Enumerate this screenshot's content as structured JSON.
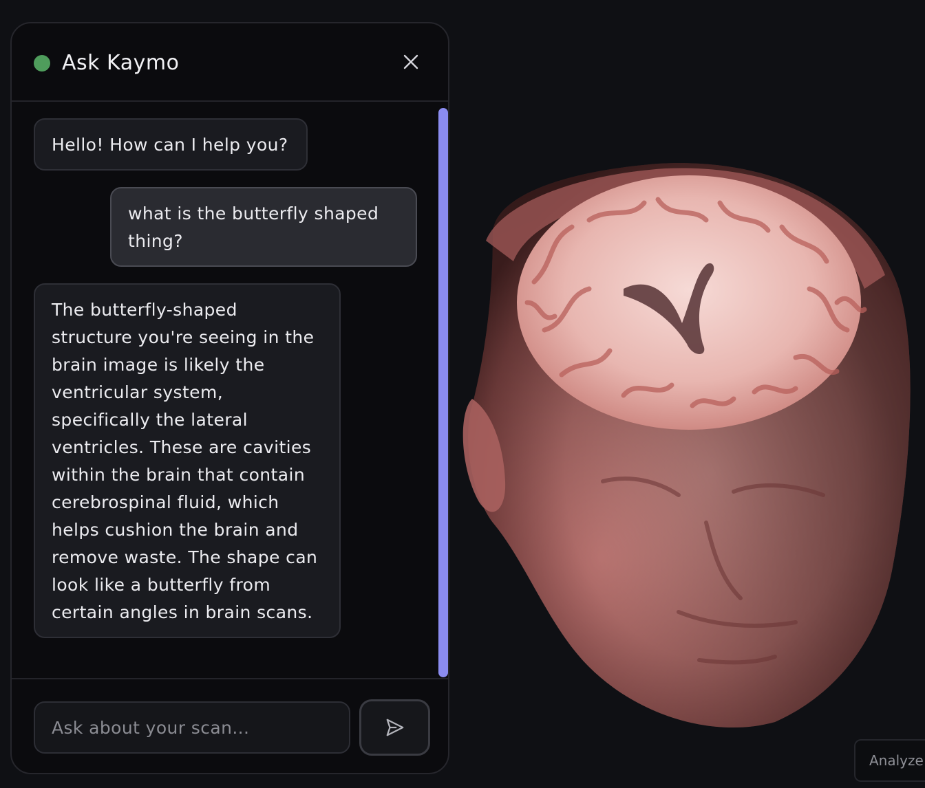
{
  "chat": {
    "title": "Ask Kaymo",
    "status_color": "#4f9d5c",
    "close_icon": "close-icon",
    "messages": [
      {
        "role": "assistant",
        "text": "Hello! How can I help you?"
      },
      {
        "role": "user",
        "text": "what is the butterfly shaped thing?"
      },
      {
        "role": "assistant",
        "text": "The butterfly-shaped structure you're seeing in the brain image is likely the ventricular system, specifically the lateral ventricles. These are cavities within the brain that contain cerebrospinal fluid, which helps cushion the brain and remove waste. The shape can look like a butterfly from certain angles in brain scans."
      }
    ],
    "input": {
      "placeholder": "Ask about your scan...",
      "value": ""
    },
    "send_icon": "send-icon",
    "scrollbar_color": "#8b8cf0"
  },
  "viewer": {
    "image": "3d-brain-mri-render",
    "analyze_label": "Analyze"
  }
}
